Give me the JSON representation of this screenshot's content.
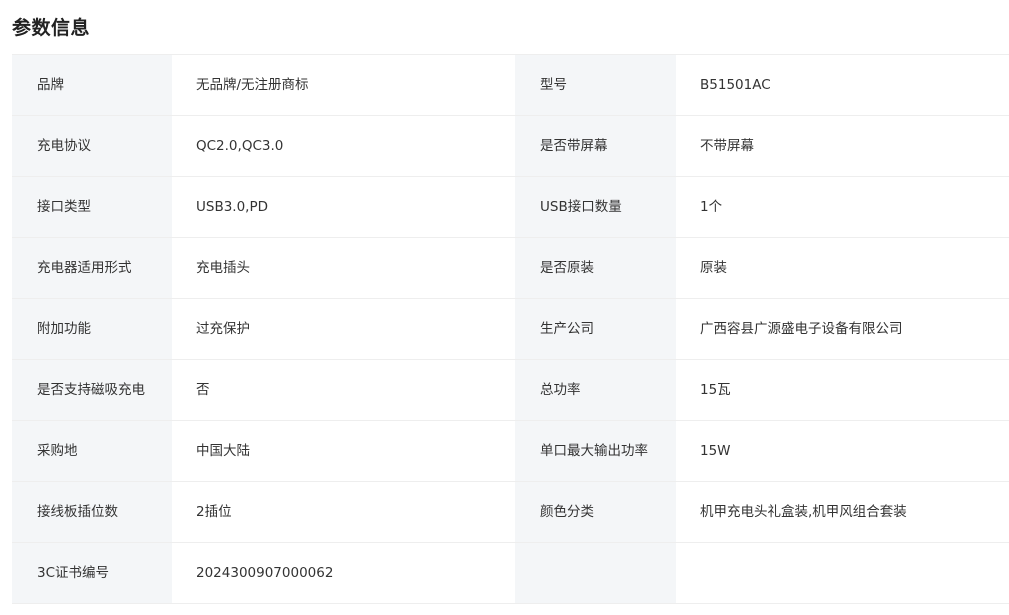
{
  "section": {
    "title": "参数信息"
  },
  "params": [
    {
      "label1": "品牌",
      "value1": "无品牌/无注册商标",
      "label2": "型号",
      "value2": "B51501AC"
    },
    {
      "label1": "充电协议",
      "value1": "QC2.0,QC3.0",
      "label2": "是否带屏幕",
      "value2": "不带屏幕"
    },
    {
      "label1": "接口类型",
      "value1": "USB3.0,PD",
      "label2": "USB接口数量",
      "value2": "1个"
    },
    {
      "label1": "充电器适用形式",
      "value1": "充电插头",
      "label2": "是否原装",
      "value2": "原装"
    },
    {
      "label1": "附加功能",
      "value1": "过充保护",
      "label2": "生产公司",
      "value2": "广西容县广源盛电子设备有限公司"
    },
    {
      "label1": "是否支持磁吸充电",
      "value1": "否",
      "label2": "总功率",
      "value2": "15瓦"
    },
    {
      "label1": "采购地",
      "value1": "中国大陆",
      "label2": "单口最大输出功率",
      "value2": "15W"
    },
    {
      "label1": "接线板插位数",
      "value1": "2插位",
      "label2": "颜色分类",
      "value2": "机甲充电头礼盒装,机甲风组合套装"
    },
    {
      "label1": "3C证书编号",
      "value1": "2024300907000062",
      "label2": "",
      "value2": ""
    }
  ]
}
